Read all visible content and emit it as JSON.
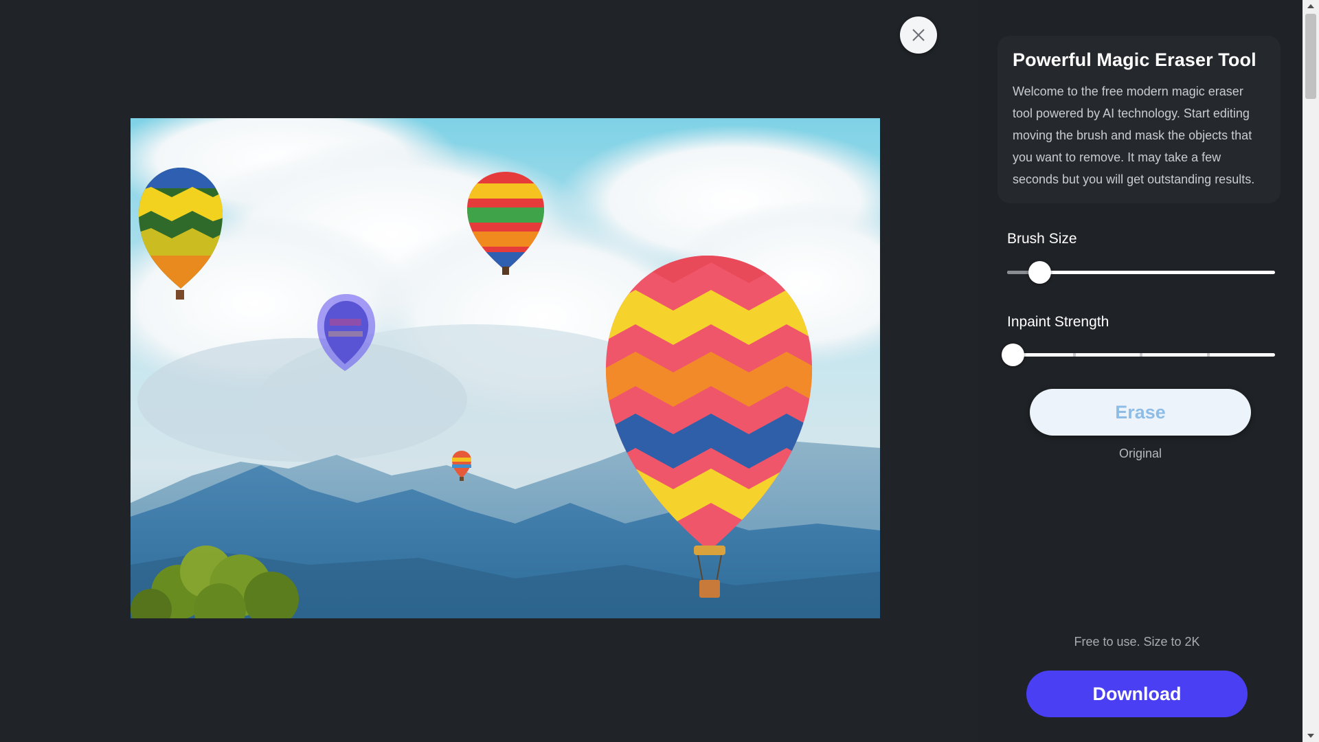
{
  "panel": {
    "title": "Powerful Magic Eraser Tool",
    "description": "Welcome to the free modern magic eraser tool powered by AI technology. Start editing moving the brush and mask the objects that you want to remove. It may take a few seconds but you will get outstanding results.",
    "brush_size": {
      "label": "Brush Size",
      "value_fraction": 0.12
    },
    "inpaint_strength": {
      "label": "Inpaint Strength",
      "value_fraction": 0.0
    },
    "erase_label": "Erase",
    "original_label": "Original",
    "free_note": "Free to use. Size to 2K",
    "download_label": "Download"
  },
  "icons": {
    "close": "close-icon",
    "scroll_up": "scroll-up-arrow-icon",
    "scroll_down": "scroll-down-arrow-icon"
  },
  "colors": {
    "background": "#202327",
    "panel_card": "#25282d",
    "erase_button_bg": "#edf3fa",
    "erase_button_text": "#8dbde6",
    "download_button": "#4a3ff2",
    "mask_overlay": "#6a5cf0"
  }
}
